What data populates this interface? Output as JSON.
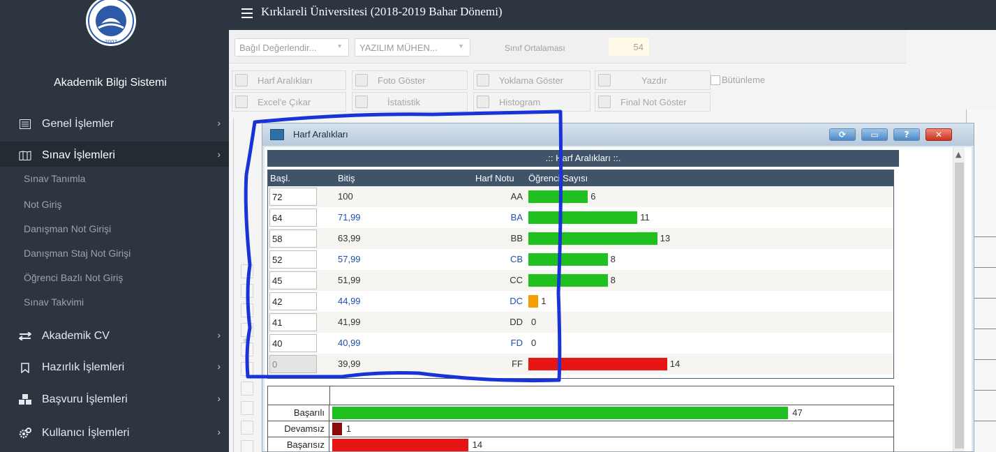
{
  "sidebar": {
    "logo_text": "KIRKLARELİ ÜNİVERSİTESİ 2007",
    "app_name": "Akademik Bilgi Sistemi",
    "menu": [
      {
        "label": "Genel İşlemler",
        "icon": "list-icon"
      },
      {
        "label": "Sınav İşlemleri",
        "icon": "map-book-icon"
      },
      {
        "label": "Akademik CV",
        "icon": "exchange-icon"
      },
      {
        "label": "Hazırlık İşlemleri",
        "icon": "bookmark-icon"
      },
      {
        "label": "Başvuru İşlemleri",
        "icon": "cubes-icon"
      },
      {
        "label": "Kullanıcı İşlemleri",
        "icon": "cogs-icon"
      }
    ],
    "submenu": [
      "Sınav Tanımla",
      "Not Giriş",
      "Danışman Not Girişi",
      "Danışman Staj Not Girişi",
      "Öğrenci Bazlı Not Giriş",
      "Sınav Takvimi"
    ]
  },
  "topbar": {
    "title": "Kırklareli Üniversitesi (2018-2019 Bahar Dönemi)"
  },
  "filters": {
    "combo1": "Bağıl Değerlendir...",
    "combo2": "YAZILIM MÜHEN...",
    "avg_label": "Sınıf Ortalaması",
    "avg_value": "54"
  },
  "toolbar": {
    "row1": [
      "Harf Aralıkları",
      "Foto Göster",
      "Yoklama Göster",
      "Yazdır"
    ],
    "row2": [
      "Excel'e Çıkar",
      "İstatistik",
      "Histogram",
      "Final Not Göster"
    ],
    "checkbox_label": "Bütünleme"
  },
  "dialog": {
    "title": "Harf Aralıkları",
    "header_band": ".:: Harf Aralıkları ::.",
    "columns": {
      "start": "Başl.",
      "end": "Bitiş",
      "grade": "Harf Notu",
      "count": "Öğrenci Sayısı"
    },
    "rows": [
      {
        "start": "72",
        "end": "100",
        "grade": "AA",
        "count": "6",
        "count_num": 6,
        "color": "#20c020"
      },
      {
        "start": "64",
        "end": "71,99",
        "grade": "BA",
        "count": "11",
        "count_num": 11,
        "color": "#20c020"
      },
      {
        "start": "58",
        "end": "63,99",
        "grade": "BB",
        "count": "13",
        "count_num": 13,
        "color": "#20c020"
      },
      {
        "start": "52",
        "end": "57,99",
        "grade": "CB",
        "count": "8",
        "count_num": 8,
        "color": "#20c020"
      },
      {
        "start": "45",
        "end": "51,99",
        "grade": "CC",
        "count": "8",
        "count_num": 8,
        "color": "#20c020"
      },
      {
        "start": "42",
        "end": "44,99",
        "grade": "DC",
        "count": "1",
        "count_num": 1,
        "color": "#f5a000"
      },
      {
        "start": "41",
        "end": "41,99",
        "grade": "DD",
        "count": "0",
        "count_num": 0,
        "color": "#e01010"
      },
      {
        "start": "40",
        "end": "40,99",
        "grade": "FD",
        "count": "0",
        "count_num": 0,
        "color": "#e01010"
      },
      {
        "start": "0",
        "end": "39,99",
        "grade": "FF",
        "count": "14",
        "count_num": 14,
        "color": "#e81515"
      }
    ],
    "summary": [
      {
        "label": "Başarılı",
        "count": "47",
        "count_num": 47,
        "color": "#20c020"
      },
      {
        "label": "Devamsız",
        "count": "1",
        "count_num": 1,
        "color": "#8b0b0b"
      },
      {
        "label": "Başarısız",
        "count": "14",
        "count_num": 14,
        "color": "#e81515"
      }
    ]
  },
  "colors": {
    "sidebar_bg": "#2c3540",
    "grid_header": "#3f5469",
    "annotation": "#1a33d8"
  }
}
